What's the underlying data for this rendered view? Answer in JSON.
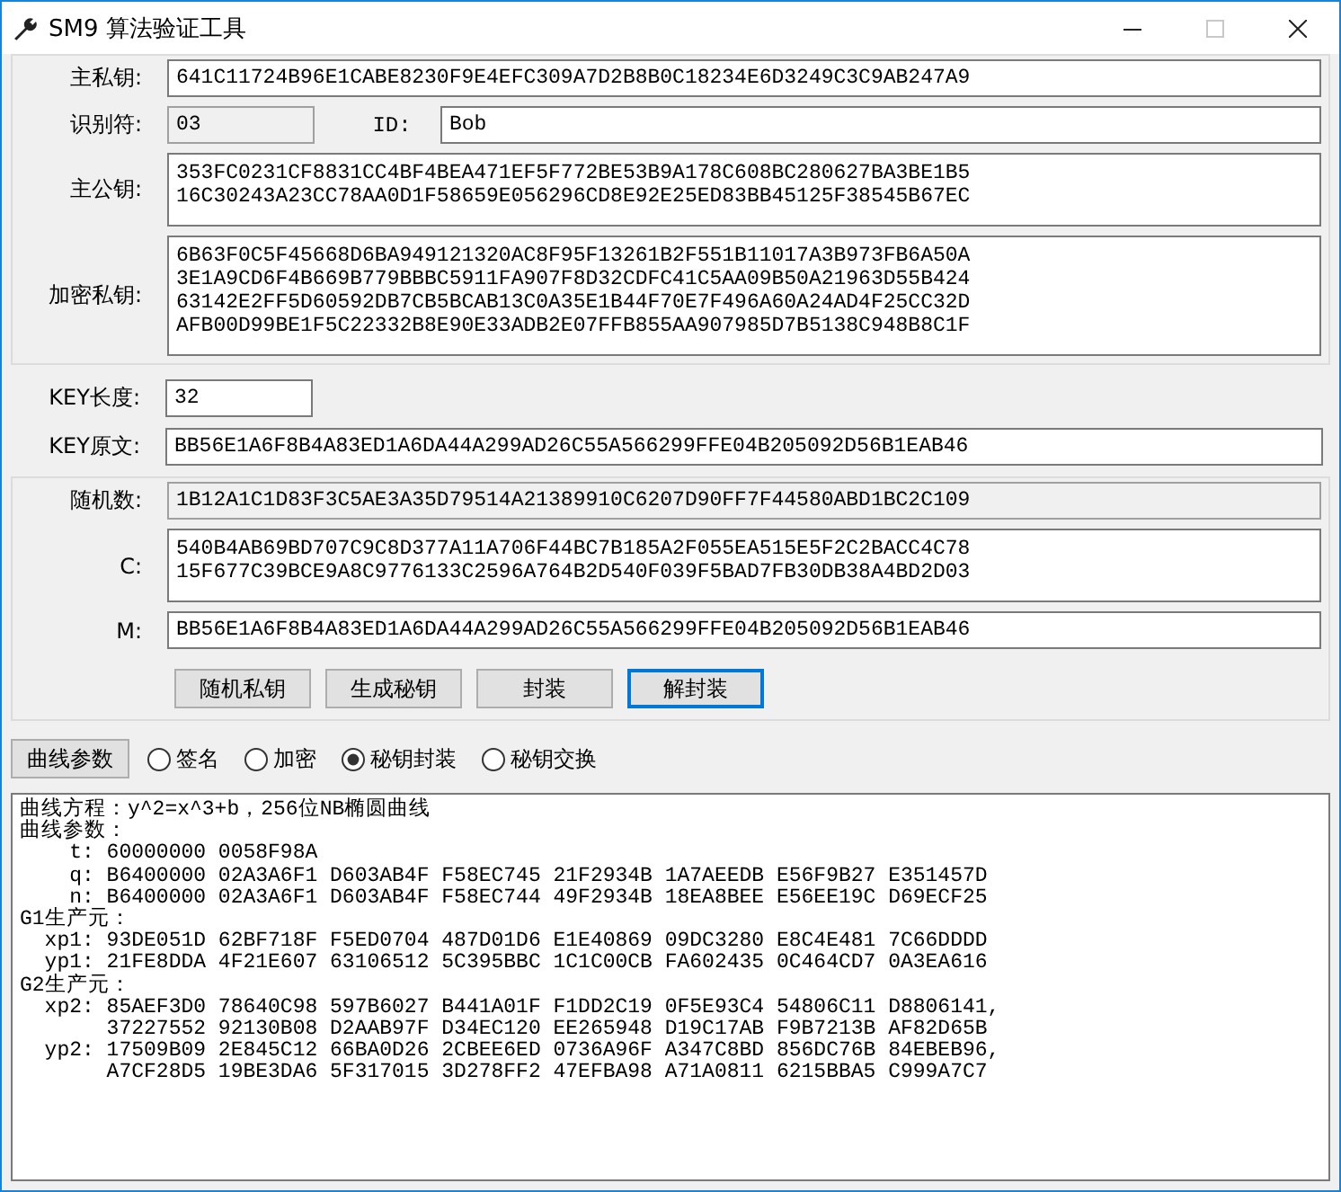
{
  "window": {
    "title": "SM9 算法验证工具"
  },
  "key_panel": {
    "master_private_key": {
      "label": "主私钥:",
      "value": "641C11724B96E1CABE8230F9E4EFC309A7D2B8B0C18234E6D3249C3C9AB247A9"
    },
    "identifier": {
      "label": "识别符:",
      "value": "03",
      "readonly": true
    },
    "id": {
      "label": "ID:",
      "value": "Bob"
    },
    "master_public_key": {
      "label": "主公钥:",
      "lines": [
        "353FC0231CF8831CC4BF4BEA471EF5F772BE53B9A178C608BC280627BA3BE1B5",
        "16C30243A23CC78AA0D1F58659E056296CD8E92E25ED83BB45125F38545B67EC"
      ]
    },
    "encryption_private_key": {
      "label": "加密私钥:",
      "lines": [
        "6B63F0C5F45668D6BA949121320AC8F95F13261B2F551B11017A3B973FB6A50A",
        "3E1A9CD6F4B669B779BBBC5911FA907F8D32CDFC41C5AA09B50A21963D55B424",
        "63142E2FF5D60592DB7CB5BCAB13C0A35E1B44F70E7F496A60A24AD4F25CC32D",
        "AFB00D99BE1F5C22332B8E90E33ADB2E07FFB855AA907985D7B5138C948B8C1F"
      ]
    }
  },
  "key_fields": [
    {
      "label": "KEY长度:",
      "value": "32",
      "kind": "short"
    },
    {
      "label": "KEY原文:",
      "value": "BB56E1A6F8B4A83ED1A6DA44A299AD26C55A566299FFE04B205092D56B1EAB46",
      "kind": "long"
    }
  ],
  "encap_panel": {
    "fields": [
      {
        "label": "随机数:",
        "lines": [
          "1B12A1C1D83F3C5AE3A35D79514A21389910C6207D90FF7F44580ABD1BC2C109"
        ],
        "readonly": true
      },
      {
        "label": "C:",
        "lines": [
          "540B4AB69BD707C9C8D377A11A706F44BC7B185A2F055EA515E5F2C2BACC4C78",
          "15F677C39BCE9A8C9776133C2596A764B2D540F039F5BAD7FB30DB38A4BD2D03"
        ],
        "readonly": false
      },
      {
        "label": "M:",
        "lines": [
          "BB56E1A6F8B4A83ED1A6DA44A299AD26C55A566299FFE04B205092D56B1EAB46"
        ],
        "readonly": false
      }
    ],
    "buttons": [
      {
        "label": "随机私钥",
        "focused": false
      },
      {
        "label": "生成秘钥",
        "focused": false
      },
      {
        "label": "封装",
        "focused": false
      },
      {
        "label": "解封装",
        "focused": true
      }
    ]
  },
  "mode_bar": {
    "button": "曲线参数",
    "options": [
      {
        "label": "签名",
        "selected": false
      },
      {
        "label": "加密",
        "selected": false
      },
      {
        "label": "秘钥封装",
        "selected": true
      },
      {
        "label": "秘钥交换",
        "selected": false
      }
    ]
  },
  "output": {
    "lines": [
      "曲线方程：y^2=x^3+b，256位NB椭圆曲线",
      "曲线参数：",
      "    t: 60000000 0058F98A",
      "    q: B6400000 02A3A6F1 D603AB4F F58EC745 21F2934B 1A7AEEDB E56F9B27 E351457D",
      "    n: B6400000 02A3A6F1 D603AB4F F58EC744 49F2934B 18EA8BEE E56EE19C D69ECF25",
      "G1生产元：",
      "  xp1: 93DE051D 62BF718F F5ED0704 487D01D6 E1E40869 09DC3280 E8C4E481 7C66DDDD",
      "  yp1: 21FE8DDA 4F21E607 63106512 5C395BBC 1C1C00CB FA602435 0C464CD7 0A3EA616",
      "G2生产元：",
      "  xp2: 85AEF3D0 78640C98 597B6027 B441A01F F1DD2C19 0F5E93C4 54806C11 D8806141,",
      "       37227552 92130B08 D2AAB97F D34EC120 EE265948 D19C17AB F9B7213B AF82D65B",
      "  yp2: 17509B09 2E845C12 66BA0D26 2CBEE6ED 0736A96F A347C8BD 856DC76B 84EBEB96,",
      "       A7CF28D5 19BE3DA6 5F317015 3D278FF2 47EFBA98 A71A0811 6215BBA5 C999A7C7"
    ]
  }
}
